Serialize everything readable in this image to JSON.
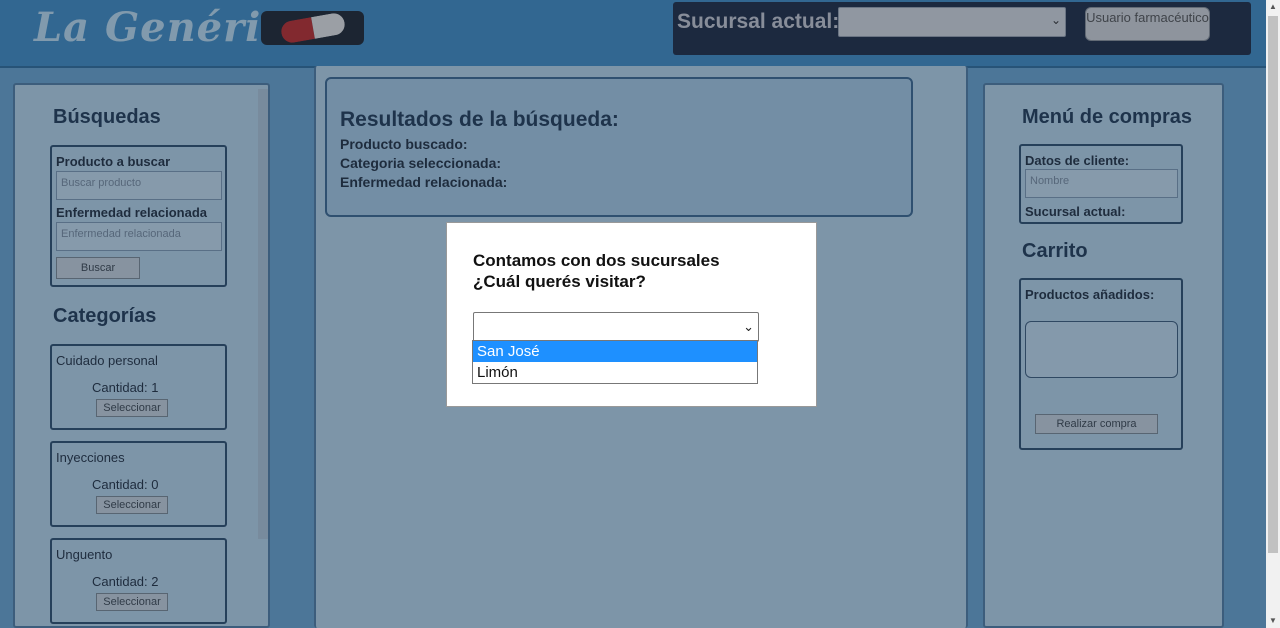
{
  "header": {
    "logo_text": "La Genérica",
    "branch_label": "Sucursal actual:",
    "branch_value": "",
    "user_button": "Usuario farmacéutico"
  },
  "left": {
    "search_title": "Búsquedas",
    "product_label": "Producto a buscar",
    "product_placeholder": "Buscar producto",
    "disease_label": "Enfermedad relacionada",
    "disease_placeholder": "Enfermedad relacionada",
    "search_button": "Buscar",
    "categories_title": "Categorías",
    "categories": [
      {
        "name": "Cuidado personal",
        "qty": "Cantidad: 1",
        "button": "Seleccionar"
      },
      {
        "name": "Inyecciones",
        "qty": "Cantidad: 0",
        "button": "Seleccionar"
      },
      {
        "name": "Unguento",
        "qty": "Cantidad: 2",
        "button": "Seleccionar"
      }
    ]
  },
  "results": {
    "title": "Resultados de la búsqueda:",
    "product": "Producto buscado:",
    "category": "Categoria seleccionada:",
    "disease": "Enfermedad relacionada:"
  },
  "right": {
    "title": "Menú de compras",
    "client_label": "Datos de cliente:",
    "name_placeholder": "Nombre",
    "branch_label": "Sucursal actual:",
    "cart_title": "Carrito",
    "added_label": "Productos añadidos:",
    "buy_button": "Realizar compra"
  },
  "modal": {
    "question_line1": "Contamos con dos sucursales",
    "question_line2": "¿Cuál querés visitar?",
    "selected": "",
    "options": [
      "San José",
      "Limón"
    ],
    "highlighted": "San José"
  }
}
